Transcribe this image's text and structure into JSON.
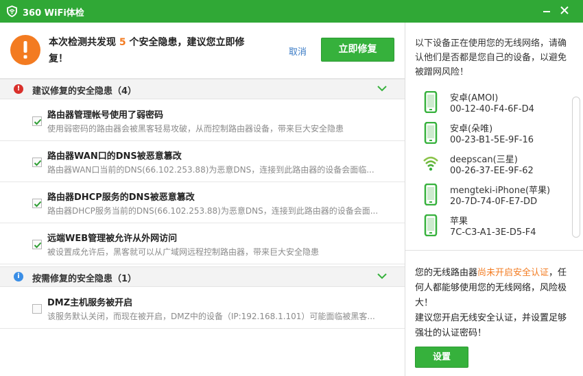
{
  "window": {
    "title": "360 WiFi体检",
    "minimize_icon": "minimize-icon",
    "close_icon": "close-icon",
    "brand_color": "#30a836"
  },
  "summary": {
    "text_before": "本次检测共发现 ",
    "count": "5",
    "text_after": " 个安全隐患，建议您立即修复！",
    "cancel_label": "取消",
    "fix_label": "立即修复",
    "accent_color": "#f37b21"
  },
  "groups": [
    {
      "title": "建议修复的安全隐患（4）",
      "icon": "warning-icon",
      "icon_color": "#d9302b",
      "items": [
        {
          "title": "路由器管理帐号使用了弱密码",
          "desc": "使用弱密码的路由器会被黑客轻易攻破，从而控制路由器设备，带来巨大安全隐患",
          "checked": true
        },
        {
          "title": "路由器WAN口的DNS被恶意篡改",
          "desc": "路由器WAN口当前的DNS(66.102.253.88)为恶意DNS，连接到此路由器的设备会面临...",
          "checked": true
        },
        {
          "title": "路由器DHCP服务的DNS被恶意篡改",
          "desc": "路由器DHCP服务当前的DNS(66.102.253.88)为恶意DNS，连接到此路由器的设备会面...",
          "checked": true
        },
        {
          "title": "远端WEB管理被允许从外网访问",
          "desc": "被设置成允许后，黑客就可以从广域网远程控制路由器，带来巨大安全隐患",
          "checked": true
        }
      ]
    },
    {
      "title": "按需修复的安全隐患（1）",
      "icon": "info-icon",
      "icon_color": "#3a8ee6",
      "items": [
        {
          "title": "DMZ主机服务被开启",
          "desc": "该服务默认关闭，而现在被开启，DMZ中的设备（IP:192.168.1.101）可能面临被黑客...",
          "checked": false
        }
      ]
    }
  ],
  "right": {
    "intro": "以下设备正在使用您的无线网络，请确认他们是否都是您自己的设备，以避免被蹭网风险！",
    "devices": [
      {
        "name": "安卓(AMOI)",
        "mac": "00-12-40-F4-6F-D4",
        "icon": "phone-icon"
      },
      {
        "name": "安卓(朵唯)",
        "mac": "00-23-B1-5E-9F-16",
        "icon": "phone-icon"
      },
      {
        "name": "deepscan(三星)",
        "mac": "00-26-37-EE-9F-62",
        "icon": "wifi-icon"
      },
      {
        "name": "mengteki-iPhone(苹果)",
        "mac": "20-7D-74-0F-E7-DD",
        "icon": "phone-icon"
      },
      {
        "name": "苹果",
        "mac": "7C-C3-A1-3E-D5-F4",
        "icon": "phone-icon"
      }
    ],
    "warn_before": "您的无线路由器",
    "warn_highlight": "尚未开启安全认证",
    "warn_after": "，任何人都能够使用您的无线网络，风险极大！",
    "advice": "建议您开启无线安全认证，并设置足够强壮的认证密码！",
    "set_label": "设置"
  }
}
